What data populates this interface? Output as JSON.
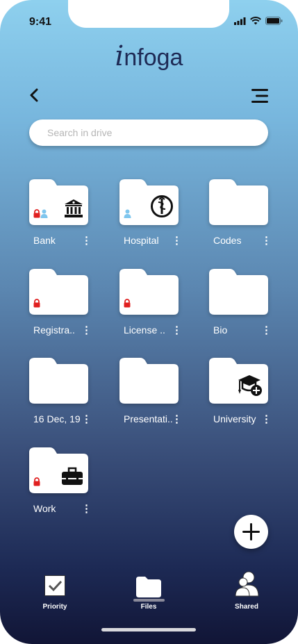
{
  "status": {
    "time": "9:41"
  },
  "brand": {
    "logo_i": "i",
    "logo_rest": "nfoga"
  },
  "search": {
    "placeholder": "Search in drive"
  },
  "folders": [
    {
      "label": "Bank",
      "emblem": "bank-icon",
      "locked": true,
      "shared": true
    },
    {
      "label": "Hospital",
      "emblem": "hospital-icon",
      "locked": false,
      "shared": true
    },
    {
      "label": "Codes",
      "emblem": "",
      "locked": false,
      "shared": false
    },
    {
      "label": "Registra..",
      "emblem": "",
      "locked": true,
      "shared": false
    },
    {
      "label": "License ..",
      "emblem": "",
      "locked": true,
      "shared": false
    },
    {
      "label": "Bio",
      "emblem": "",
      "locked": false,
      "shared": false
    },
    {
      "label": "16 Dec, 19",
      "emblem": "",
      "locked": false,
      "shared": false
    },
    {
      "label": "Presentati..",
      "emblem": "",
      "locked": false,
      "shared": false
    },
    {
      "label": "University",
      "emblem": "graduation-cap-icon",
      "locked": false,
      "shared": false
    },
    {
      "label": "Work",
      "emblem": "briefcase-icon",
      "locked": true,
      "shared": false
    }
  ],
  "more_glyph": "⋮",
  "tabbar": {
    "priority": "Priority",
    "files": "Files",
    "shared": "Shared",
    "active": "files"
  },
  "colors": {
    "lock": "#e02020",
    "shared_person": "#7fc6ee",
    "brand": "#1e2a55"
  }
}
